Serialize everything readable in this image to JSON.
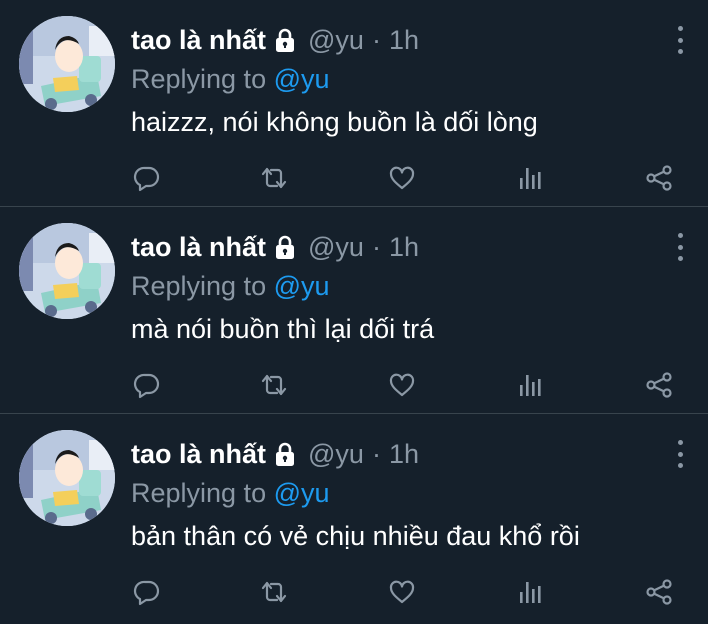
{
  "tweets": [
    {
      "name": "tao là nhất",
      "handle": "@yu",
      "dot": "·",
      "time": "1h",
      "replying_prefix": "Replying to",
      "replying_to": "@yu",
      "text": "haizzz, nói không buồn là dối lòng"
    },
    {
      "name": "tao là nhất",
      "handle": "@yu",
      "dot": "·",
      "time": "1h",
      "replying_prefix": "Replying to",
      "replying_to": "@yu",
      "text": "mà nói buồn thì lại dối trá"
    },
    {
      "name": "tao là nhất",
      "handle": "@yu",
      "dot": "·",
      "time": "1h",
      "replying_prefix": "Replying to",
      "replying_to": "@yu",
      "text": "bản thân có vẻ chịu nhiều đau khổ rồi"
    }
  ],
  "icons": {
    "lock": "lock-icon",
    "more": "more-vertical-icon",
    "reply": "reply-icon",
    "retweet": "retweet-icon",
    "like": "heart-icon",
    "analytics": "analytics-icon",
    "share": "share-icon"
  },
  "colors": {
    "background": "#15202b",
    "muted": "#8b98a5",
    "accent": "#1d9bf0",
    "divider": "#38444d"
  }
}
